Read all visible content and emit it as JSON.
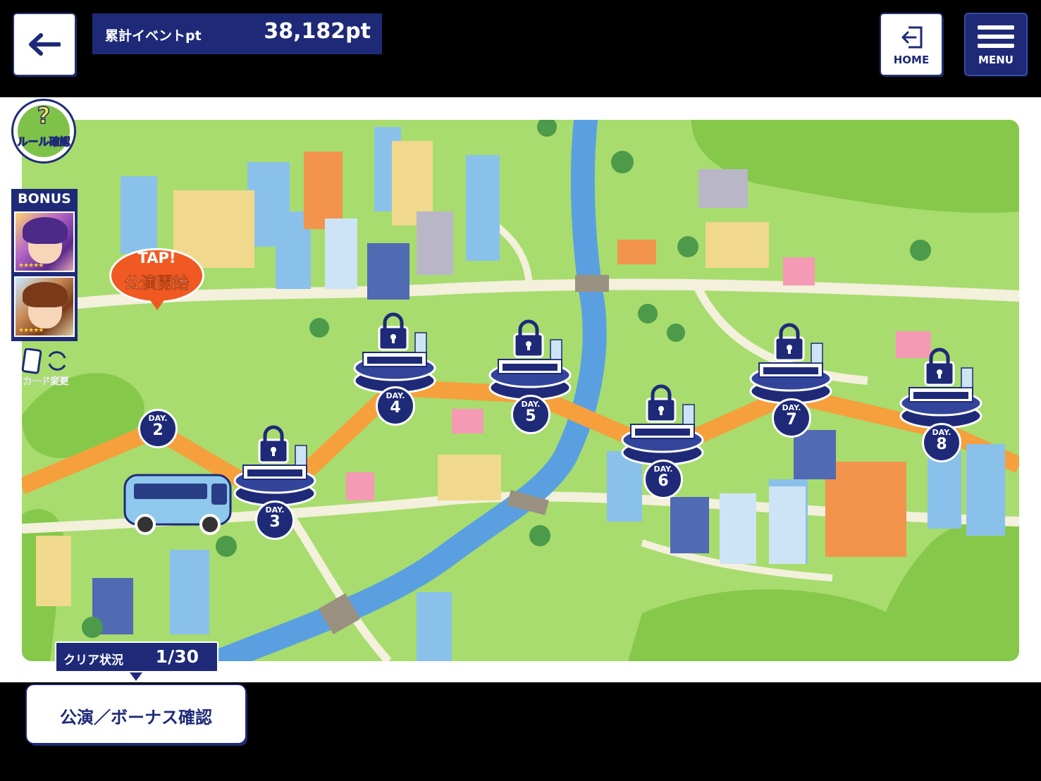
{
  "header": {
    "points_label": "累計イベントpt",
    "points_value": "38,182pt",
    "home_label": "HOME",
    "menu_label": "MENU"
  },
  "sidebar": {
    "rule_label": "ルール確認",
    "rule_symbol": "?",
    "bonus_label": "BONUS",
    "card_change_label": "カード変更"
  },
  "map": {
    "tap_line1": "TAP!",
    "tap_line2": "公演開始",
    "day_label": "DAY.",
    "days": [
      {
        "n": "2",
        "state": "current"
      },
      {
        "n": "3",
        "state": "locked"
      },
      {
        "n": "4",
        "state": "locked"
      },
      {
        "n": "5",
        "state": "locked"
      },
      {
        "n": "6",
        "state": "locked"
      },
      {
        "n": "7",
        "state": "locked"
      },
      {
        "n": "8",
        "state": "locked"
      }
    ]
  },
  "footer": {
    "clear_label": "クリア状況",
    "clear_value": "1/30",
    "perf_button_label": "公演／ボーナス確認"
  },
  "colors": {
    "navy": "#1e2a78",
    "grass": "#a8dc6e",
    "river": "#5aa0e0",
    "route": "#f5a03c",
    "bubble": "#f05a22"
  }
}
